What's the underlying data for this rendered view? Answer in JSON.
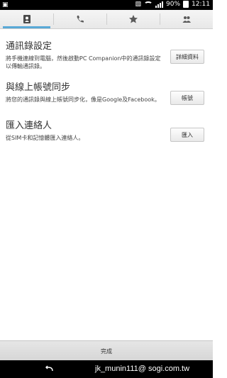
{
  "status_bar": {
    "battery": "90%",
    "time": "12:11"
  },
  "tabs": [
    {
      "icon": "contacts-icon",
      "active": true
    },
    {
      "icon": "phone-icon",
      "active": false
    },
    {
      "icon": "star-icon",
      "active": false
    },
    {
      "icon": "groups-icon",
      "active": false
    }
  ],
  "sections": [
    {
      "title": "通訊錄設定",
      "desc": "將手機連線到電腦，然後啟動PC Companion中的通訊錄設定以傳輸通訊錄。",
      "button": "詳細資料"
    },
    {
      "title": "與線上帳號同步",
      "desc": "將您的通訊錄與線上帳號同步化，像是Google及Facebook。",
      "button": "帳號"
    },
    {
      "title": "匯入連絡人",
      "desc": "從SIM卡和記憶體匯入連絡人。",
      "button": "匯入"
    }
  ],
  "done_label": "完成",
  "watermark": "jk_munin111@ sogi.com.tw"
}
